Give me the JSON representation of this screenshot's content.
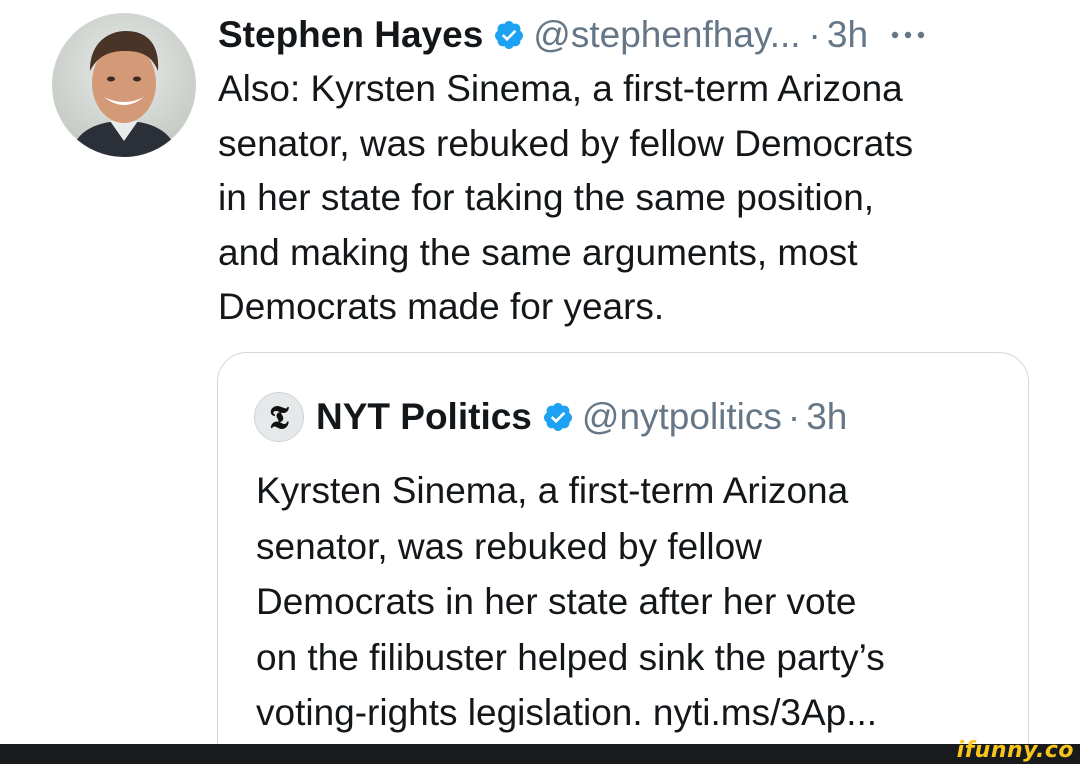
{
  "tweet": {
    "author_name": "Stephen Hayes",
    "handle": "@stephenfhay...",
    "separator": "·",
    "time": "3h",
    "text": "Also: Kyrsten Sinema, a first-term Arizona\nsenator, was rebuked by fellow Democrats\nin her state for taking the same position,\nand making the same arguments, most\nDemocrats made for years.",
    "avatar_icon": "profile-photo",
    "more_icon": "more-horizontal-icon",
    "verified_icon": "verified-badge-icon"
  },
  "quoted_tweet": {
    "logo_glyph": "𝕿",
    "author_name": "NYT Politics",
    "handle": "@nytpolitics",
    "separator": "·",
    "time": "3h",
    "text": "Kyrsten Sinema, a first-term Arizona\nsenator, was rebuked by fellow\nDemocrats in her state after her vote\non the filibuster helped sink the party’s\nvoting-rights legislation. nyti.ms/3Ap..."
  },
  "watermark": "ifunny.co",
  "colors": {
    "text": "#14171a",
    "secondary": "#657786",
    "verified": "#1da1f2",
    "border": "#d3d8dc",
    "watermark": "#f7c51e"
  }
}
